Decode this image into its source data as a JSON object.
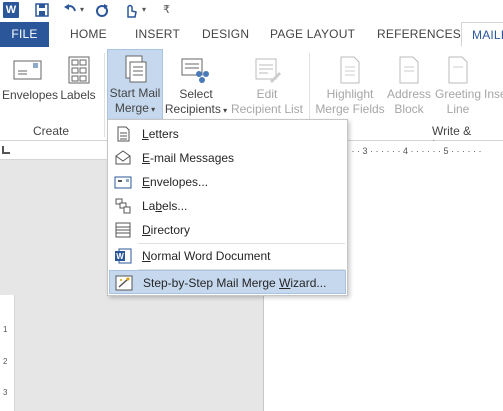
{
  "quick_access": {
    "app_icon": "word-logo",
    "app_letter": "W",
    "items": [
      "save-icon",
      "undo-icon",
      "undo-dropdown-icon",
      "redo-icon",
      "touch-mode-icon",
      "customize-qat-icon"
    ]
  },
  "tabs": [
    {
      "label": "FILE"
    },
    {
      "label": "HOME"
    },
    {
      "label": "INSERT"
    },
    {
      "label": "DESIGN"
    },
    {
      "label": "PAGE LAYOUT"
    },
    {
      "label": "REFERENCES"
    },
    {
      "label": "MAILI"
    }
  ],
  "ribbon": {
    "create": {
      "group_label": "Create",
      "envelopes": "Envelopes",
      "labels": "Labels"
    },
    "start_mail_merge": {
      "line1": "Start Mail",
      "line2": "Merge"
    },
    "select_recipients": {
      "line1": "Select",
      "line2": "Recipients"
    },
    "edit_recipient_list": {
      "line1": "Edit",
      "line2": "Recipient List"
    },
    "highlight_merge_fields": {
      "line1": "Highlight",
      "line2": "Merge Fields"
    },
    "address_block": {
      "line1": "Address",
      "line2": "Block"
    },
    "greeting_line": {
      "line1": "Greeting",
      "line2": "Line"
    },
    "insert_truncated": {
      "line1": "Inse"
    },
    "write_insert_group_label": "Write & Insert"
  },
  "ruler": {
    "ticks": "· · · 3 · · · · · · 4 · · · · · · 5 · · · · · ·",
    "v_ticks": [
      "1",
      "2",
      "3"
    ]
  },
  "menu": {
    "items": [
      {
        "label_pre": "",
        "label_ul": "L",
        "label_post": "etters",
        "icon": "letter-icon"
      },
      {
        "label_pre": "",
        "label_ul": "E",
        "label_post": "-mail Messages",
        "icon": "email-icon"
      },
      {
        "label_pre": "",
        "label_ul": "E",
        "label_post": "nvelopes...",
        "icon": "envelope-icon"
      },
      {
        "label_pre": "La",
        "label_ul": "b",
        "label_post": "els...",
        "icon": "labels-icon"
      },
      {
        "label_pre": "",
        "label_ul": "D",
        "label_post": "irectory",
        "icon": "directory-icon"
      },
      {
        "label_pre": "",
        "label_ul": "N",
        "label_post": "ormal Word Document",
        "icon": "word-doc-icon"
      },
      {
        "label_pre": "Step-by-Step Mail Merge ",
        "label_ul": "W",
        "label_post": "izard...",
        "icon": "wizard-icon"
      }
    ]
  }
}
